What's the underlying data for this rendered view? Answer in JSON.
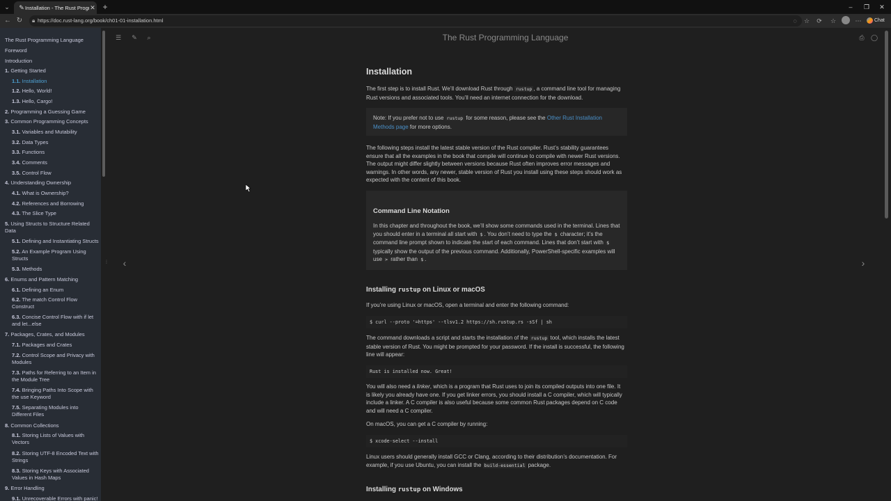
{
  "browser": {
    "tab_title": "Installation - The Rust Programming Language",
    "url": "https://doc.rust-lang.org/book/ch01-01-installation.html",
    "copilot_label": "Chat"
  },
  "page": {
    "book_title": "The Rust Programming Language",
    "sidebar": {
      "items": [
        {
          "num": "",
          "label": "The Rust Programming Language"
        },
        {
          "num": "",
          "label": "Foreword"
        },
        {
          "num": "",
          "label": "Introduction"
        },
        {
          "num": "1.",
          "label": "Getting Started"
        },
        {
          "num": "1.1.",
          "label": "Installation"
        },
        {
          "num": "1.2.",
          "label": "Hello, World!"
        },
        {
          "num": "1.3.",
          "label": "Hello, Cargo!"
        },
        {
          "num": "2.",
          "label": "Programming a Guessing Game"
        },
        {
          "num": "3.",
          "label": "Common Programming Concepts"
        },
        {
          "num": "3.1.",
          "label": "Variables and Mutability"
        },
        {
          "num": "3.2.",
          "label": "Data Types"
        },
        {
          "num": "3.3.",
          "label": "Functions"
        },
        {
          "num": "3.4.",
          "label": "Comments"
        },
        {
          "num": "3.5.",
          "label": "Control Flow"
        },
        {
          "num": "4.",
          "label": "Understanding Ownership"
        },
        {
          "num": "4.1.",
          "label": "What is Ownership?"
        },
        {
          "num": "4.2.",
          "label": "References and Borrowing"
        },
        {
          "num": "4.3.",
          "label": "The Slice Type"
        },
        {
          "num": "5.",
          "label": "Using Structs to Structure Related"
        },
        {
          "num": "",
          "label": "Data"
        },
        {
          "num": "5.1.",
          "label": "Defining and Instantiating Structs"
        },
        {
          "num": "5.2.",
          "label": "An Example Program Using"
        },
        {
          "num": "",
          "label": "Structs"
        },
        {
          "num": "5.3.",
          "label": "Methods"
        },
        {
          "num": "6.",
          "label": "Enums and Pattern Matching"
        },
        {
          "num": "6.1.",
          "label": "Defining an Enum"
        },
        {
          "num": "6.2.",
          "label": "The match Control Flow"
        },
        {
          "num": "",
          "label": "Construct"
        },
        {
          "num": "6.3.",
          "label": "Concise Control Flow with if let"
        },
        {
          "num": "",
          "label": "and let...else"
        },
        {
          "num": "7.",
          "label": "Packages, Crates, and Modules"
        },
        {
          "num": "7.1.",
          "label": "Packages and Crates"
        },
        {
          "num": "7.2.",
          "label": "Control Scope and Privacy with"
        },
        {
          "num": "",
          "label": "Modules"
        },
        {
          "num": "7.3.",
          "label": "Paths for Referring to an Item in"
        },
        {
          "num": "",
          "label": "the Module Tree"
        },
        {
          "num": "7.4.",
          "label": "Bringing Paths Into Scope with"
        },
        {
          "num": "",
          "label": "the use Keyword"
        },
        {
          "num": "7.5.",
          "label": "Separating Modules into"
        },
        {
          "num": "",
          "label": "Different Files"
        },
        {
          "num": "8.",
          "label": "Common Collections"
        },
        {
          "num": "8.1.",
          "label": "Storing Lists of Values with"
        },
        {
          "num": "",
          "label": "Vectors"
        },
        {
          "num": "8.2.",
          "label": "Storing UTF-8 Encoded Text with"
        },
        {
          "num": "",
          "label": "Strings"
        },
        {
          "num": "8.3.",
          "label": "Storing Keys with Associated"
        },
        {
          "num": "",
          "label": "Values in Hash Maps"
        },
        {
          "num": "9.",
          "label": "Error Handling"
        },
        {
          "num": "9.1.",
          "label": "Unrecoverable Errors with panic!"
        }
      ]
    },
    "content": {
      "h1": "Installation",
      "p1a": "The first step is to install Rust. We’ll download Rust through ",
      "p1_code": "rustup",
      "p1b": ", a command line tool for managing Rust versions and associated tools. You’ll need an internet connection for the download.",
      "note_a": "Note: If you prefer not to use ",
      "note_code": "rustup",
      "note_b": " for some reason, please see the ",
      "note_link": "Other Rust Installation Methods page",
      "note_c": " for more options.",
      "p2": "The following steps install the latest stable version of the Rust compiler. Rust’s stability guarantees ensure that all the examples in the book that compile will continue to compile with newer Rust versions. The output might differ slightly between versions because Rust often improves error messages and warnings. In other words, any newer, stable version of Rust you install using these steps should work as expected with the content of this book.",
      "cli_title": "Command Line Notation",
      "cli_a": "In this chapter and throughout the book, we’ll show some commands used in the terminal. Lines that you should enter in a terminal all start with ",
      "cli_code1": "$",
      "cli_b": ". You don’t need to type the ",
      "cli_code2": "$",
      "cli_c": " character; it’s the command line prompt shown to indicate the start of each command. Lines that don’t start with ",
      "cli_code3": "$",
      "cli_d": " typically show the output of the previous command. Additionally, PowerShell-specific examples will use ",
      "cli_code4": ">",
      "cli_e": " rather than ",
      "cli_code5": "$",
      "cli_f": ".",
      "h2_linux_a": "Installing ",
      "h2_linux_code": "rustup",
      "h2_linux_b": " on Linux or macOS",
      "p3": "If you’re using Linux or macOS, open a terminal and enter the following command:",
      "code1": "$ curl --proto '=https' --tlsv1.2 https://sh.rustup.rs -sSf | sh",
      "p4a": "The command downloads a script and starts the installation of the ",
      "p4_code": "rustup",
      "p4b": " tool, which installs the latest stable version of Rust. You might be prompted for your password. If the install is successful, the following line will appear:",
      "code2": "Rust is installed now. Great!",
      "p5a": "You will also need a ",
      "p5_em": "linker",
      "p5b": ", which is a program that Rust uses to join its compiled outputs into one file. It is likely you already have one. If you get linker errors, you should install a C compiler, which will typically include a linker. A C compiler is also useful because some common Rust packages depend on C code and will need a C compiler.",
      "p6": "On macOS, you can get a C compiler by running:",
      "code3": "$ xcode-select --install",
      "p7a": "Linux users should generally install GCC or Clang, according to their distribution’s documentation. For example, if you use Ubuntu, you can install the ",
      "p7_code": "build-essential",
      "p7b": " package.",
      "h2_win_a": "Installing ",
      "h2_win_code": "rustup",
      "h2_win_b": " on Windows"
    }
  }
}
